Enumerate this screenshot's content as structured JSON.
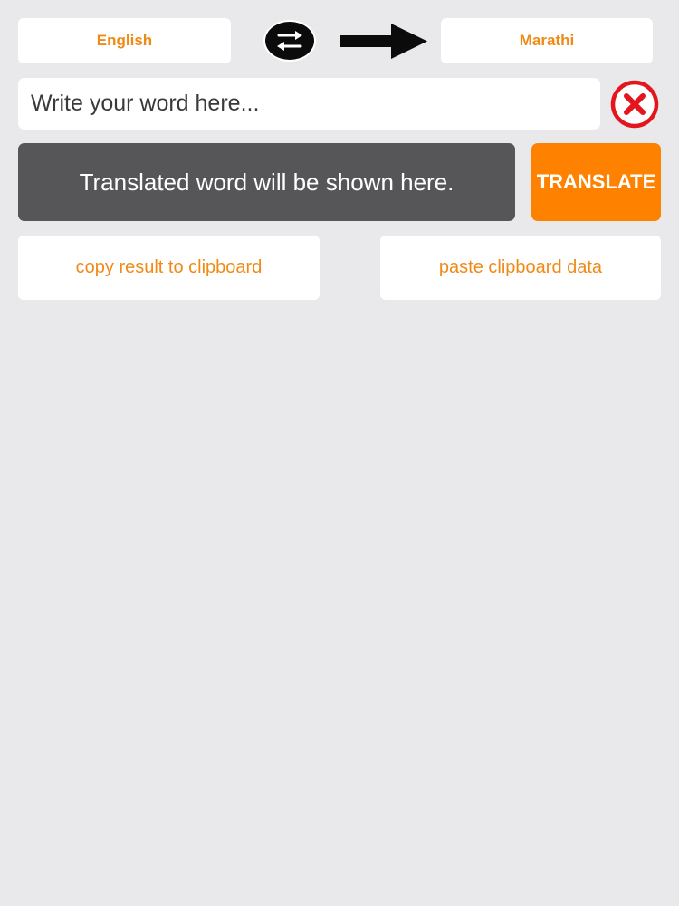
{
  "languages": {
    "source": "English",
    "target": "Marathi"
  },
  "icons": {
    "swap": "swap-arrows-icon",
    "direction": "right-arrow-icon",
    "clear": "close-circle-icon"
  },
  "input": {
    "placeholder": "Write your word here...",
    "value": ""
  },
  "result": {
    "text": "Translated word will be shown here."
  },
  "actions": {
    "translate_label": "TRANSLATE",
    "copy_label": "copy result to clipboard",
    "paste_label": "paste clipboard data"
  },
  "colors": {
    "accent": "#ff8100",
    "label_orange": "#f08a17",
    "result_bg": "#565558",
    "clear_red": "#e3161e",
    "background": "#e9e8ea"
  }
}
